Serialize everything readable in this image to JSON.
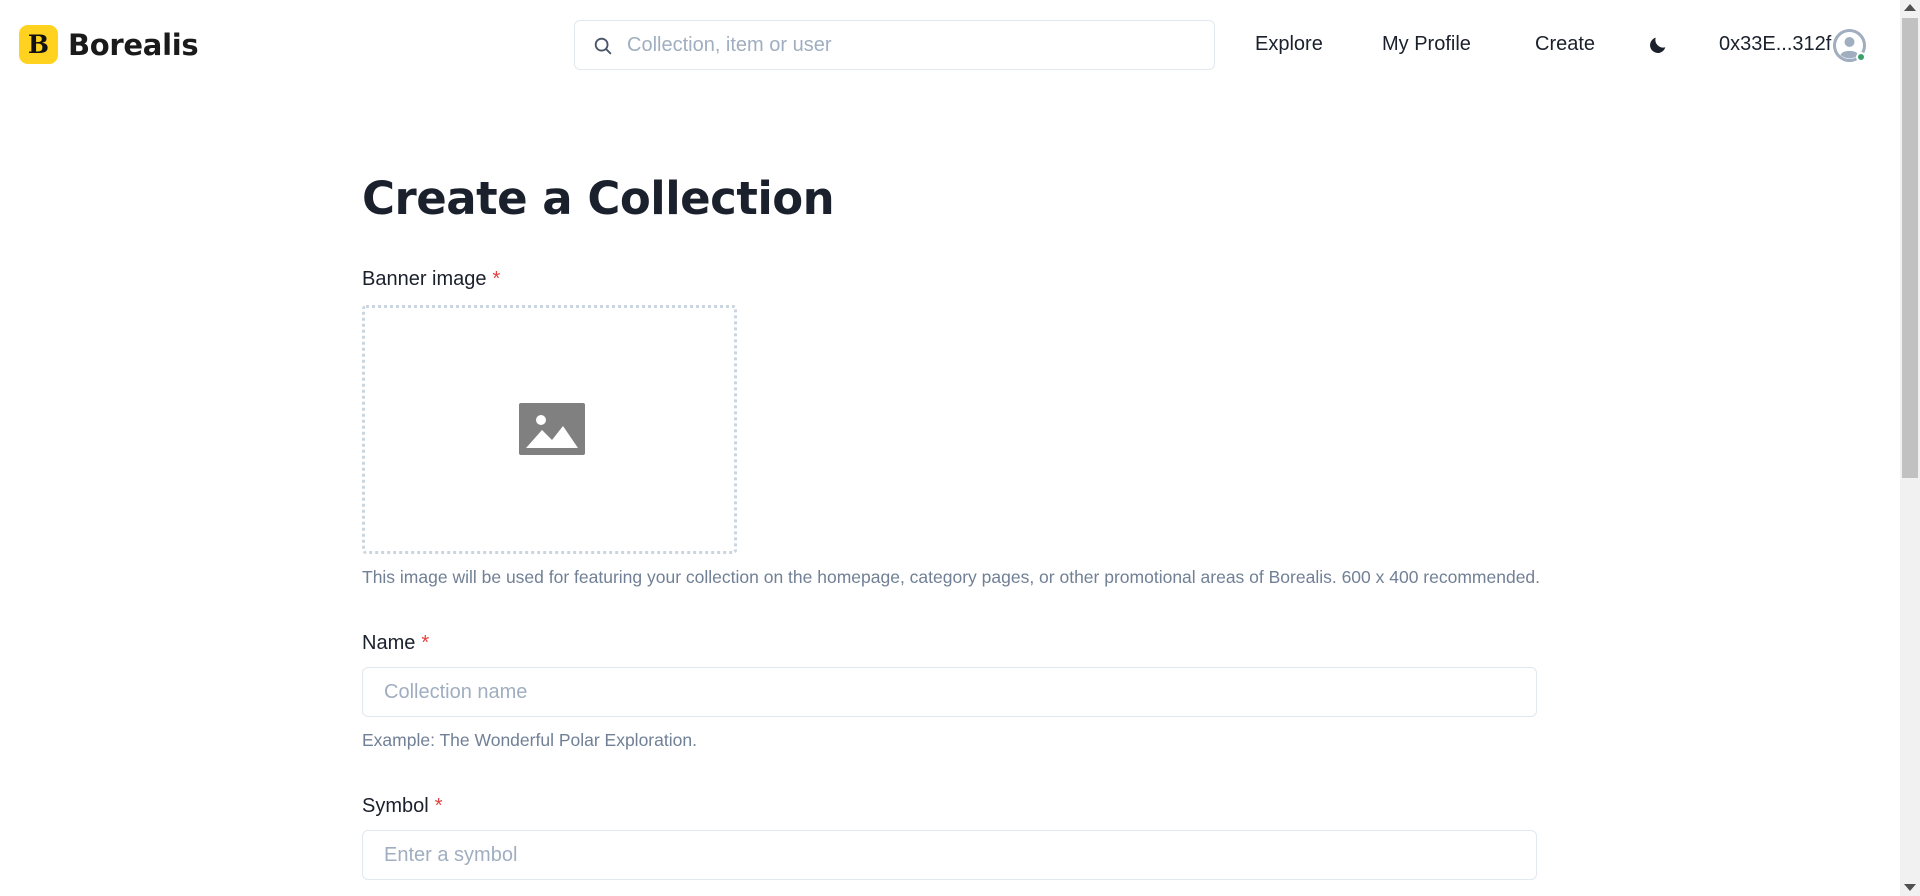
{
  "header": {
    "logo_mark": "B",
    "logo_text": "Borealis",
    "search_placeholder": "Collection, item or user",
    "nav": {
      "explore": "Explore",
      "my_profile": "My Profile",
      "create": "Create"
    },
    "wallet_address": "0x33E...312f",
    "status_color": "#38a169"
  },
  "main": {
    "title": "Create a Collection",
    "banner": {
      "label": "Banner image",
      "required_mark": "*",
      "help": "This image will be used for featuring your collection on the homepage, category pages, or other promotional areas of Borealis. 600 x 400 recommended."
    },
    "name": {
      "label": "Name",
      "required_mark": "*",
      "placeholder": "Collection name",
      "help": "Example: The Wonderful Polar Exploration."
    },
    "symbol": {
      "label": "Symbol",
      "required_mark": "*",
      "placeholder": "Enter a symbol"
    }
  },
  "icons": {
    "search": "search-icon",
    "theme": "moon-icon",
    "avatar": "user-avatar-icon",
    "banner": "image-placeholder-icon"
  },
  "colors": {
    "brand": "#ffd21f",
    "required": "#e53e3e",
    "muted": "#718096"
  }
}
